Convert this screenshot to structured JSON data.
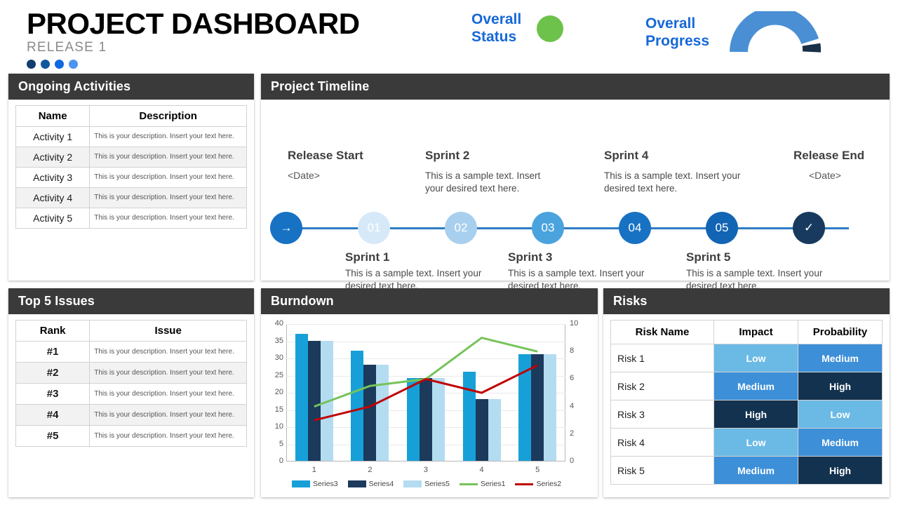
{
  "header": {
    "title": "PROJECT DASHBOARD",
    "subtitle": "RELEASE 1",
    "dot_colors": [
      "#123f6d",
      "#11569f",
      "#0f6ae0",
      "#4d94f0"
    ],
    "status_label": "Overall\nStatus",
    "status_label_line1": "Overall",
    "status_label_line2": "Status",
    "status_color": "#6cc24a",
    "progress_label_line1": "Overall",
    "progress_label_line2": "Progress",
    "gauge": {
      "filled_color": "#4a8fd4",
      "remaining_color": "#1a3048",
      "percent": 80
    },
    "accent_blue": "#1668d8"
  },
  "activities": {
    "panel_title": "Ongoing Activities",
    "columns": [
      "Name",
      "Description"
    ],
    "rows": [
      {
        "name": "Activity  1",
        "description": "This is your  description. Insert your text here."
      },
      {
        "name": "Activity  2",
        "description": "This is your  description. Insert your text here."
      },
      {
        "name": "Activity  3",
        "description": "This is your  description. Insert your text here."
      },
      {
        "name": "Activity  4",
        "description": "This is your  description. Insert your text here."
      },
      {
        "name": "Activity  5",
        "description": "This is your  description. Insert your text here."
      }
    ]
  },
  "timeline": {
    "panel_title": "Project Timeline",
    "start": {
      "label": "Release Start",
      "date": "<Date>"
    },
    "end": {
      "label": "Release End",
      "date": "<Date>"
    },
    "nodes": [
      {
        "glyph": "→",
        "color": "#1772c4"
      },
      {
        "glyph": "01",
        "color": "#d6e9f9"
      },
      {
        "glyph": "02",
        "color": "#a8cfee"
      },
      {
        "glyph": "03",
        "color": "#4ba3de"
      },
      {
        "glyph": "04",
        "color": "#1772c4"
      },
      {
        "glyph": "05",
        "color": "#1264b4"
      },
      {
        "glyph": "✓",
        "color": "#173a5e"
      }
    ],
    "sprints_top": [
      {
        "label": "Sprint 2",
        "text": "This is a sample text. Insert your desired text here."
      },
      {
        "label": "Sprint 4",
        "text": "This is a sample text. Insert your desired text here."
      }
    ],
    "sprints_bottom": [
      {
        "label": "Sprint 1",
        "text": "This is a sample text. Insert your desired text here."
      },
      {
        "label": "Sprint 3",
        "text": "This is a sample text. Insert your desired text here."
      },
      {
        "label": "Sprint 5",
        "text": "This is a sample text. Insert your desired text here."
      }
    ]
  },
  "issues": {
    "panel_title": "Top 5 Issues",
    "columns": [
      "Rank",
      "Issue"
    ],
    "rows": [
      {
        "rank": "#1",
        "issue": "This is your  description. Insert your text here."
      },
      {
        "rank": "#2",
        "issue": "This is your  description. Insert your text here."
      },
      {
        "rank": "#3",
        "issue": "This is your  description. Insert your text here."
      },
      {
        "rank": "#4",
        "issue": "This is your  description. Insert your text here."
      },
      {
        "rank": "#5",
        "issue": "This is your  description. Insert your text here."
      }
    ]
  },
  "risks": {
    "panel_title": "Risks",
    "columns": [
      "Risk Name",
      "Impact",
      "Probability"
    ],
    "level_colors": {
      "Low": "#6bb9e5",
      "Medium": "#3d8fd8",
      "High": "#12324f"
    },
    "rows": [
      {
        "name": "Risk 1",
        "impact": "Low",
        "probability": "Medium"
      },
      {
        "name": "Risk 2",
        "impact": "Medium",
        "probability": "High"
      },
      {
        "name": "Risk 3",
        "impact": "High",
        "probability": "Low"
      },
      {
        "name": "Risk 4",
        "impact": "Low",
        "probability": "Medium"
      },
      {
        "name": "Risk 5",
        "impact": "Medium",
        "probability": "High"
      }
    ]
  },
  "burndown": {
    "panel_title": "Burndown"
  },
  "chart_data": {
    "type": "bar",
    "title": "Burndown",
    "categories": [
      "1",
      "2",
      "3",
      "4",
      "5"
    ],
    "xlabel": "",
    "ylabel": "",
    "ylim": [
      0,
      40
    ],
    "y_ticks": [
      0,
      5,
      10,
      15,
      20,
      25,
      30,
      35,
      40
    ],
    "y2lim": [
      0,
      10
    ],
    "y2_ticks": [
      0,
      2,
      4,
      6,
      8,
      10
    ],
    "grid": true,
    "legend_position": "bottom",
    "series": [
      {
        "name": "Series3",
        "kind": "bar",
        "axis": "left",
        "color": "#17a0d8",
        "values": [
          37,
          32,
          24,
          26,
          31
        ]
      },
      {
        "name": "Series4",
        "kind": "bar",
        "axis": "left",
        "color": "#1b3a5c",
        "values": [
          35,
          28,
          24,
          18,
          31
        ]
      },
      {
        "name": "Series5",
        "kind": "bar",
        "axis": "left",
        "color": "#b4dcf1",
        "values": [
          35,
          28,
          24,
          18,
          31
        ]
      },
      {
        "name": "Series1",
        "kind": "line",
        "axis": "right",
        "color": "#76c35a",
        "values": [
          4,
          5.5,
          6,
          9,
          8
        ]
      },
      {
        "name": "Series2",
        "kind": "line",
        "axis": "right",
        "color": "#c00000",
        "values": [
          3,
          4,
          6,
          5,
          7
        ]
      }
    ]
  }
}
